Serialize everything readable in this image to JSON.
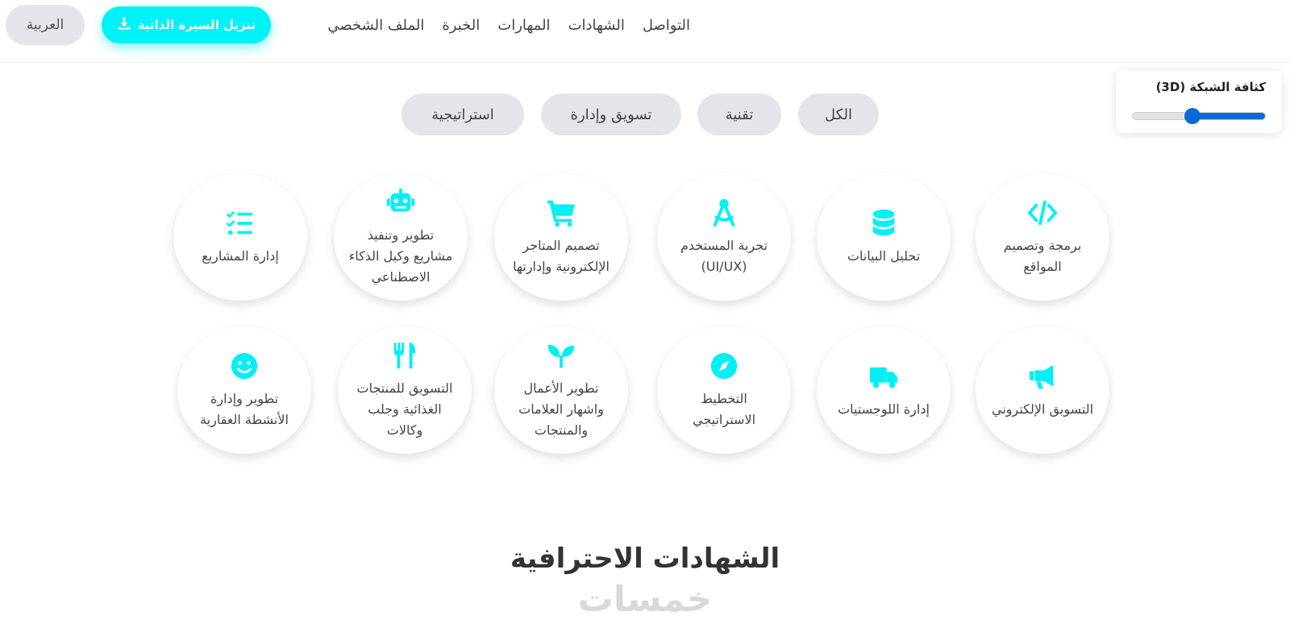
{
  "header": {
    "language_label": "العربية",
    "download_cv_label": "تنزيل السيرة الذاتية",
    "nav": [
      "الملف الشخصي",
      "الخبرة",
      "المهارات",
      "الشهادات",
      "التواصل"
    ]
  },
  "density": {
    "title": "كثافة الشبكة (3D)",
    "value_fraction": 0.55
  },
  "filters": [
    "الكل",
    "تقنية",
    "تسويق وإدارة",
    "استراتيجية"
  ],
  "skills_row1": [
    {
      "label": "برمجة وتصميم المواقع",
      "icon": "code-icon"
    },
    {
      "label": "تحليل البيانات",
      "icon": "database-icon"
    },
    {
      "label": "تجربة المستخدم (UI/UX)",
      "icon": "compass-drafting-icon"
    },
    {
      "label": "تصميم المتاجر الإلكترونية وإدارتها",
      "icon": "cart-icon"
    },
    {
      "label": "تطوير وتنفيذ مشاريع وكيل الذكاء الاصطناعي",
      "icon": "robot-icon"
    },
    {
      "label": "إدارة المشاريع",
      "icon": "list-check-icon"
    }
  ],
  "skills_row2": [
    {
      "label": "التسويق الإلكتروني",
      "icon": "megaphone-icon"
    },
    {
      "label": "إدارة اللوجستيات",
      "icon": "truck-icon"
    },
    {
      "label": "التخطيط الاستراتيجي",
      "icon": "compass-icon"
    },
    {
      "label": "تطوير الأعمال واشهار العلامات والمنتجات",
      "icon": "seedling-icon"
    },
    {
      "label": "التسويق للمنتجات الغذائية وجلب وكالات",
      "icon": "utensils-icon"
    },
    {
      "label": "تطوير وإدارة الأنشطة العقارية",
      "icon": "smile-icon"
    }
  ],
  "section_title": "الشهادات الاحترافية",
  "watermark": "خمسات",
  "colors": {
    "accent": "#00f2f7",
    "slider": "#0b6ad6",
    "pill": "#e4e5ea"
  }
}
